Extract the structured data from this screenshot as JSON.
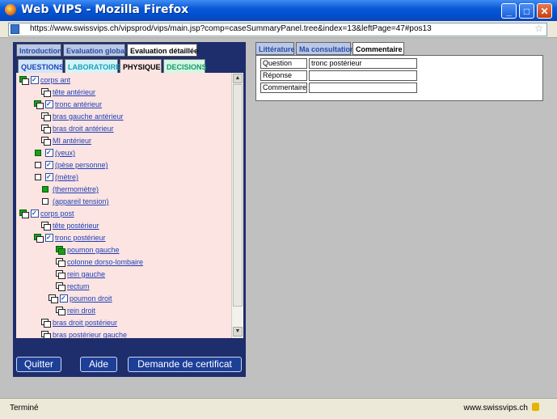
{
  "window": {
    "title": "Web VIPS - Mozilla Firefox"
  },
  "browser": {
    "url": "https://www.swissvips.ch/vipsprod/vips/main.jsp?comp=caseSummaryPanel.tree&index=13&leftPage=47#pos13",
    "status": "Terminé",
    "status_domain": "www.swissvips.ch"
  },
  "tabs_main": [
    {
      "label": "Introduction"
    },
    {
      "label": "Evaluation globale"
    },
    {
      "label": "Evaluation détaillée"
    }
  ],
  "tabs_sub": [
    {
      "label": "QUESTIONS",
      "color": "#1f3fb8",
      "bg": "#cfe8f8"
    },
    {
      "label": "LABORATOIRE",
      "color": "#1aa0b8",
      "bg": "#d5f4f8"
    },
    {
      "label": "PHYSIQUE",
      "color": "#000000",
      "bg": "#fbe4e1"
    },
    {
      "label": "DECISIONS",
      "color": "#139a6a",
      "bg": "#d5f7e4"
    }
  ],
  "tree": [
    {
      "label": "corps ant",
      "icon": "dblg",
      "check": true
    },
    {
      "label": "tête antérieur",
      "icon": "dbl",
      "check": false
    },
    {
      "label": "tronc antérieur",
      "icon": "dblg",
      "check": true
    },
    {
      "label": "bras gauche antérieur",
      "icon": "dbl",
      "check": false
    },
    {
      "label": "bras droit antérieur",
      "icon": "dbl",
      "check": false
    },
    {
      "label": "MI antérieur",
      "icon": "dbl",
      "check": false
    },
    {
      "label": "(yeux)",
      "icon": "sqg",
      "check": true
    },
    {
      "label": "(pèse personne)",
      "icon": "sq",
      "check": true
    },
    {
      "label": "(mètre)",
      "icon": "sq",
      "check": true
    },
    {
      "label": "(thermomètre)",
      "icon": "sqg",
      "check": false
    },
    {
      "label": "(appareil tension)",
      "icon": "sq",
      "check": false
    },
    {
      "label": "corps post",
      "icon": "dblg",
      "check": true
    },
    {
      "label": "tête postérieur",
      "icon": "dbl",
      "check": false
    },
    {
      "label": "tronc postérieur",
      "icon": "dblg",
      "check": true
    },
    {
      "label": "poumon gauche",
      "icon": "dblgg",
      "check": false
    },
    {
      "label": "colonne dorso-lombaire",
      "icon": "dbl",
      "check": false
    },
    {
      "label": "rein gauche",
      "icon": "dbl",
      "check": false
    },
    {
      "label": "rectum",
      "icon": "dbl",
      "check": false
    },
    {
      "label": "poumon droit",
      "icon": "dbl",
      "check": true
    },
    {
      "label": "rein droit",
      "icon": "dbl",
      "check": false
    },
    {
      "label": "bras droit postérieur",
      "icon": "dbl",
      "check": false
    },
    {
      "label": "bras postérieur gauche",
      "icon": "dbl",
      "check": false
    }
  ],
  "buttons": {
    "quit": "Quitter",
    "help": "Aide",
    "certificate": "Demande de certificat"
  },
  "tabs_right": [
    {
      "label": "Littérature"
    },
    {
      "label": "Ma consultation"
    },
    {
      "label": "Commentaire"
    }
  ],
  "form": [
    {
      "label": "Question",
      "value": "tronc postérieur"
    },
    {
      "label": "Réponse",
      "value": ""
    },
    {
      "label": "Commentaire",
      "value": ""
    }
  ],
  "icons": {
    "browser": "firefox-icon",
    "lock": "lock-icon",
    "star": "bookmark-star-icon"
  }
}
